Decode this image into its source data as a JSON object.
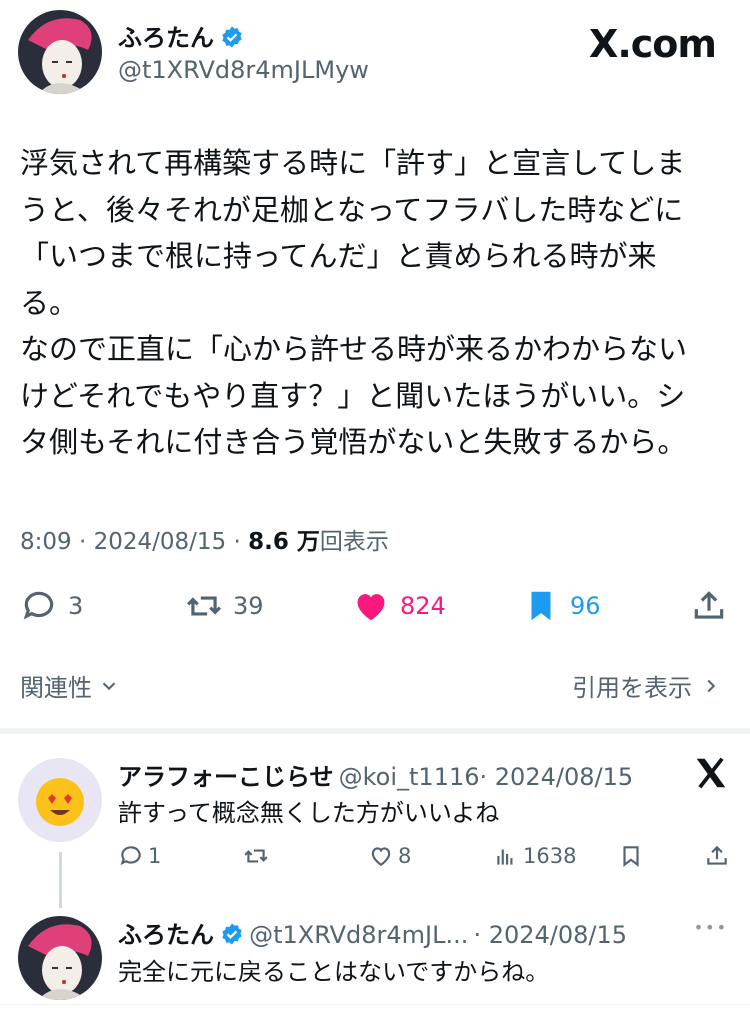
{
  "brand": "X.com",
  "tweet": {
    "author_name": "ふろたん",
    "author_handle": "@t1XRVd8r4mJLMyw",
    "text": "浮気されて再構築する時に「許す」と宣言してしま\nうと、後々それが足枷となってフラバした時などに\n「いつまで根に持ってんだ」と責められる時が来\nる。\nなので正直に「心から許せる時が来るかわからない\nけどそれでもやり直す？」と聞いたほうがいい。シ\nタ側もそれに付き合う覚悟がないと失敗するから。",
    "time": "8:09 · 2024/08/15 · ",
    "views": "8.6 万",
    "views_suffix": "回表示",
    "replies": "3",
    "retweets": "39",
    "likes": "824",
    "bookmarks": "96"
  },
  "related_label": "関連性",
  "quotes_label": "引用を表示",
  "replies": [
    {
      "name": "アラフォーこじらせ",
      "handle": "@koi_t1116",
      "date": "· 2024/08/15",
      "text": "許すって概念無くした方がいいよね",
      "replies": "1",
      "likes": "8",
      "views": "1638"
    },
    {
      "name": "ふろたん",
      "handle": "@t1XRVd8r4mJL...",
      "date": "· 2024/08/15",
      "text": "完全に元に戻ることはないですからね。",
      "more": "•••"
    }
  ],
  "colors": {
    "accent": "#1d9bf0",
    "like": "#f91880",
    "muted": "#536471"
  }
}
